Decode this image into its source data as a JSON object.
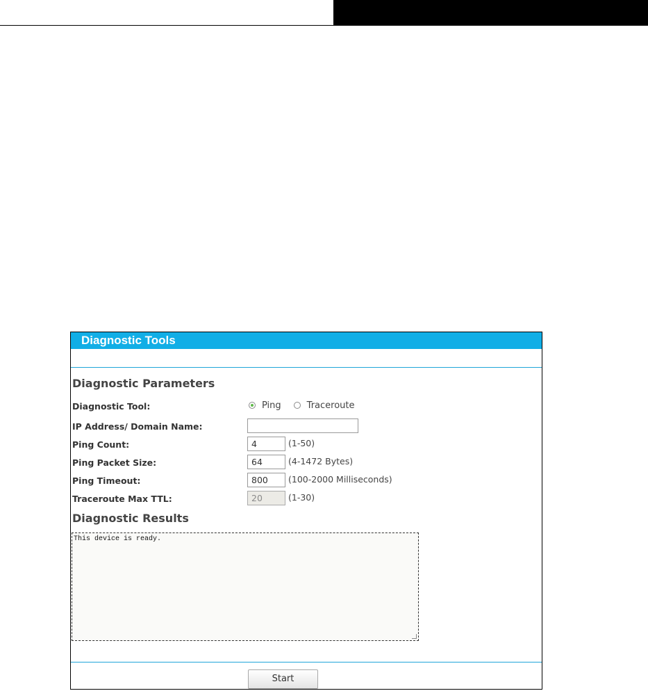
{
  "panel": {
    "title": "Diagnostic Tools"
  },
  "parameters": {
    "heading": "Diagnostic Parameters",
    "diagnostic_tool": {
      "label": "Diagnostic Tool:",
      "options": [
        "Ping",
        "Traceroute"
      ],
      "selected": "Ping"
    },
    "ip_address": {
      "label": "IP Address/ Domain Name:",
      "value": ""
    },
    "ping_count": {
      "label": "Ping Count:",
      "value": "4",
      "hint": "(1-50)"
    },
    "ping_packet_size": {
      "label": "Ping Packet Size:",
      "value": "64",
      "hint": "(4-1472 Bytes)"
    },
    "ping_timeout": {
      "label": "Ping Timeout:",
      "value": "800",
      "hint": "(100-2000 Milliseconds)"
    },
    "traceroute_max_ttl": {
      "label": "Traceroute Max TTL:",
      "value": "20",
      "hint": "(1-30)"
    }
  },
  "results": {
    "heading": "Diagnostic Results",
    "text": "This device is ready."
  },
  "actions": {
    "start_label": "Start"
  },
  "colors": {
    "title_bar": "#11aee6",
    "divider": "#1ea5d9",
    "radio_selected": "#5eb84a"
  }
}
